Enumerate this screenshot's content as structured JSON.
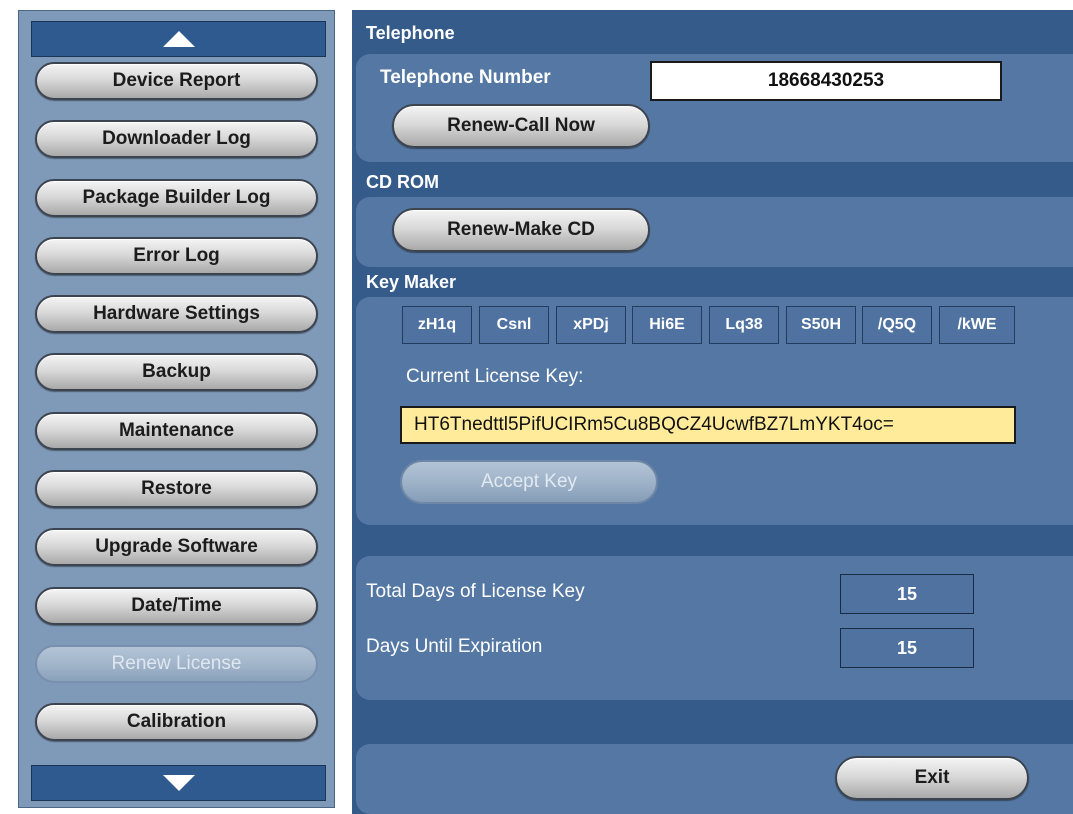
{
  "sidebar": {
    "scroll_up_icon": "triangle-up",
    "scroll_down_icon": "triangle-down",
    "items": [
      {
        "label": "Device Report",
        "enabled": true
      },
      {
        "label": "Downloader Log",
        "enabled": true
      },
      {
        "label": "Package Builder Log",
        "enabled": true
      },
      {
        "label": "Error Log",
        "enabled": true
      },
      {
        "label": "Hardware Settings",
        "enabled": true
      },
      {
        "label": "Backup",
        "enabled": true
      },
      {
        "label": "Maintenance",
        "enabled": true
      },
      {
        "label": "Restore",
        "enabled": true
      },
      {
        "label": "Upgrade Software",
        "enabled": true
      },
      {
        "label": "Date/Time",
        "enabled": true
      },
      {
        "label": "Renew License",
        "enabled": false
      },
      {
        "label": "Calibration",
        "enabled": true
      }
    ]
  },
  "telephone": {
    "title": "Telephone",
    "number_label": "Telephone Number",
    "number_value": "18668430253",
    "renew_button": "Renew-Call Now"
  },
  "cdrom": {
    "title": "CD ROM",
    "renew_button": "Renew-Make CD"
  },
  "keymaker": {
    "title": "Key Maker",
    "key_segments": [
      "zH1q",
      "Csnl",
      "xPDj",
      "Hi6E",
      "Lq38",
      "S50H",
      "/Q5Q",
      "/kWE"
    ],
    "current_key_label": "Current License Key:",
    "current_key_value": "HT6Tnedttl5PifUCIRm5Cu8BQCZ4UcwfBZ7LmYKT4oc=",
    "accept_button": "Accept Key"
  },
  "license": {
    "total_days_label": "Total Days of License Key",
    "total_days_value": "15",
    "days_until_label": "Days Until Expiration",
    "days_until_value": "15"
  },
  "footer": {
    "exit_button": "Exit"
  },
  "colors": {
    "panel_bg": "#345b8a",
    "section_bg": "#5478a3",
    "sidebar_bg": "#7f99b8",
    "license_field_bg": "#ffeb9a"
  }
}
